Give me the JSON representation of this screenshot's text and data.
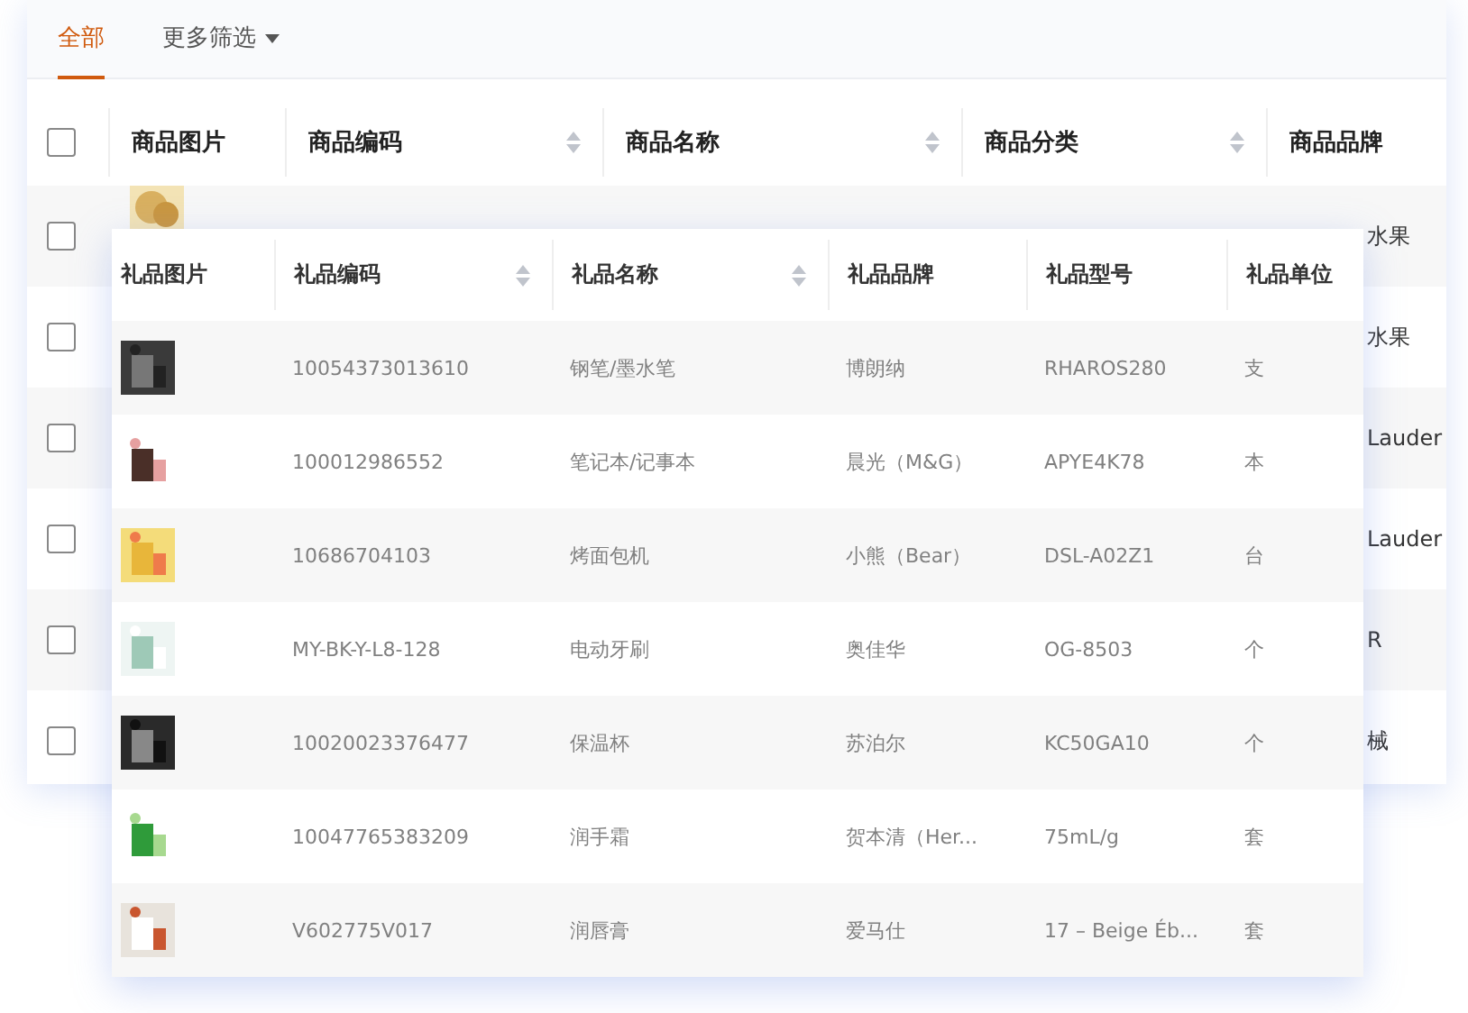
{
  "tabs": [
    {
      "label": "全部",
      "selected": true,
      "kind": "tab"
    },
    {
      "label": "更多筛选",
      "selected": false,
      "kind": "dropdown"
    }
  ],
  "product_table": {
    "columns": [
      {
        "label": "商品图片",
        "sortable": false
      },
      {
        "label": "商品编码",
        "sortable": true
      },
      {
        "label": "商品名称",
        "sortable": true
      },
      {
        "label": "商品分类",
        "sortable": true
      },
      {
        "label": "商品品牌",
        "sortable": false
      }
    ],
    "header_checked": false,
    "rows": [
      {
        "checked": false,
        "brand": "水果"
      },
      {
        "checked": false,
        "brand": "水果"
      },
      {
        "checked": false,
        "brand": "Lauder"
      },
      {
        "checked": false,
        "brand": "Lauder"
      },
      {
        "checked": false,
        "brand": "R"
      },
      {
        "checked": false,
        "brand": "械"
      }
    ]
  },
  "gift_table": {
    "columns": [
      {
        "label": "礼品图片",
        "sortable": false
      },
      {
        "label": "礼品编码",
        "sortable": true
      },
      {
        "label": "礼品名称",
        "sortable": true
      },
      {
        "label": "礼品品牌",
        "sortable": false
      },
      {
        "label": "礼品型号",
        "sortable": false
      },
      {
        "label": "礼品单位",
        "sortable": false
      }
    ],
    "rows": [
      {
        "code": "10054373013610",
        "name": "钢笔/墨水笔",
        "brand": "博朗纳",
        "model": "RHAROS280",
        "unit": "支"
      },
      {
        "code": "100012986552",
        "name": "笔记本/记事本",
        "brand": "晨光（M&G）",
        "model": "APYE4K78",
        "unit": "本"
      },
      {
        "code": "10686704103",
        "name": "烤面包机",
        "brand": "小熊（Bear）",
        "model": "DSL-A02Z1",
        "unit": "台"
      },
      {
        "code": "MY-BK-Y-L8-128",
        "name": "电动牙刷",
        "brand": "奥佳华",
        "model": "OG-8503",
        "unit": "个"
      },
      {
        "code": "10020023376477",
        "name": "保温杯",
        "brand": "苏泊尔",
        "model": "KC50GA10",
        "unit": "个"
      },
      {
        "code": "1004776538320​9",
        "name": "润手霜",
        "brand": "贺本清（Her...",
        "model": "75mL/g",
        "unit": "套"
      },
      {
        "code": "V602775V017",
        "name": "润唇膏",
        "brand": "爱马仕",
        "model": "17 – Beige Éb...",
        "unit": "套"
      }
    ]
  }
}
